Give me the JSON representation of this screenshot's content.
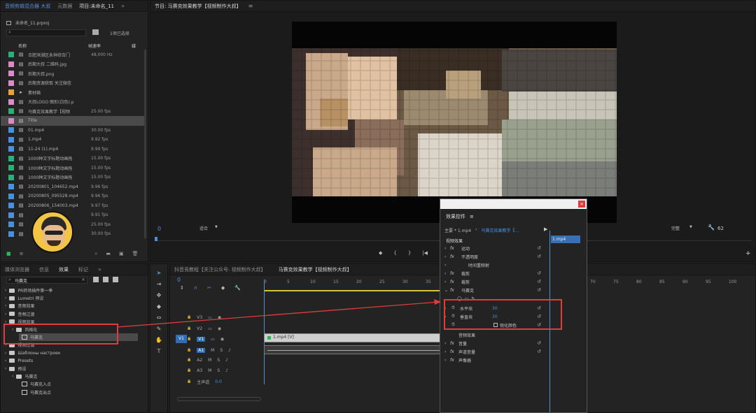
{
  "project_panel": {
    "tabs": [
      "音频剪辑混合器 大叔",
      "元数据",
      "项目:未命名_11"
    ],
    "file": "未命名_11.prproj",
    "search_placeholder": "",
    "count": "1项已选择",
    "col_name": "名称",
    "col_rate": "帧速率",
    "col_extra": "媒",
    "items": [
      {
        "color": "#27b07a",
        "name": "合肥滨湖区永祥综合门",
        "rate": "48,000 Hz"
      },
      {
        "color": "#d98cc8",
        "name": "后期大叔 二维码.jpg",
        "rate": ""
      },
      {
        "color": "#d98cc8",
        "name": "后期大叔.png",
        "rate": ""
      },
      {
        "color": "#d98cc8",
        "name": "后期资源获取 关注微信",
        "rate": ""
      },
      {
        "color": "#e8a23a",
        "name": "素材箱",
        "rate": ""
      },
      {
        "color": "#d98cc8",
        "name": "大叔LOGO 图形(白色).p",
        "rate": ""
      },
      {
        "color": "#27b07a",
        "name": "马赛克效果教学【视频",
        "rate": "25.00 fps"
      },
      {
        "color": "#d98cc8",
        "name": "Title",
        "rate": ""
      },
      {
        "color": "#4a90e2",
        "name": "01.mp4",
        "rate": "30.00 fps"
      },
      {
        "color": "#4a90e2",
        "name": "1.mp4",
        "rate": "9.92 fps"
      },
      {
        "color": "#4a90e2",
        "name": "11-24 (1).mp4",
        "rate": "9.99 fps"
      },
      {
        "color": "#27b07a",
        "name": "1000种文字标题动画拖",
        "rate": "15.00 fps"
      },
      {
        "color": "#27b07a",
        "name": "1000种文字标题动画拖",
        "rate": "15.00 fps"
      },
      {
        "color": "#27b07a",
        "name": "1000种文字标题动画拖",
        "rate": "15.00 fps"
      },
      {
        "color": "#4a90e2",
        "name": "20200801_104652.mp4",
        "rate": "9.96 fps"
      },
      {
        "color": "#4a90e2",
        "name": "20200805_095528.mp4",
        "rate": "9.96 fps"
      },
      {
        "color": "#4a90e2",
        "name": "20200806_154003.mp4",
        "rate": "9.97 fps"
      },
      {
        "color": "#4a90e2",
        "name": "",
        "rate": "9.91 fps"
      },
      {
        "color": "#4a90e2",
        "name": "",
        "rate": "25.00 fps"
      },
      {
        "color": "#4a90e2",
        "name": "",
        "rate": "30.00 fps"
      }
    ]
  },
  "program_monitor": {
    "title": "节目: 马赛克效果教学【视频制作大叔】",
    "timecode": "0",
    "fit": "适合",
    "quality": "完整",
    "end_time": "62"
  },
  "effects_panel": {
    "tabs": [
      "媒体浏览器",
      "信息",
      "效果",
      "标记"
    ],
    "search_value": "马赛克",
    "tree": [
      {
        "label": "PR转场插件第一季",
        "level": 0
      },
      {
        "label": "Lumetri 预设",
        "level": 0
      },
      {
        "label": "音频效果",
        "level": 0
      },
      {
        "label": "音频过渡",
        "level": 0
      },
      {
        "label": "视频效果",
        "level": 0
      },
      {
        "label": "风格化",
        "level": 1
      },
      {
        "label": "马赛克",
        "level": 2
      },
      {
        "label": "视频过渡",
        "level": 0
      },
      {
        "label": "Шаблоны настроек",
        "level": 0
      },
      {
        "label": "Presets",
        "level": 0
      },
      {
        "label": "预设",
        "level": 0
      },
      {
        "label": "马赛克",
        "level": 1
      },
      {
        "label": "马赛克入点",
        "level": 2
      },
      {
        "label": "马赛克出点",
        "level": 2
      }
    ]
  },
  "timeline": {
    "tabs": [
      "抖音竞教程【关注公众号: 视频制作大叔】",
      "马赛克效果教学【视频制作大叔】"
    ],
    "timecode": "0",
    "ruler": [
      "0",
      "5",
      "10",
      "15",
      "20",
      "25",
      "30",
      "35",
      "70",
      "75",
      "80",
      "85",
      "90",
      "95",
      "100"
    ],
    "tracks": [
      "V3",
      "V2",
      "V1",
      "A1",
      "A2",
      "A3",
      "主声道"
    ],
    "v1_source": "V1",
    "clip_label": "1.mp4 [V]",
    "master_value": "0.0"
  },
  "effect_controls": {
    "title": "效果控件",
    "master": "主要 * 1.mp4",
    "sequence": "马赛克效果教学【...",
    "clip_tag": "1.mp4",
    "section": "视频效果",
    "rows": [
      {
        "label": "运动",
        "fx": true
      },
      {
        "label": "不透明度",
        "fx": true
      },
      {
        "label": "时间重映射",
        "fx": false
      },
      {
        "label": "裁剪",
        "fx": true
      },
      {
        "label": "裁剪",
        "fx": true
      },
      {
        "label": "马赛克",
        "fx": true
      }
    ],
    "props": [
      {
        "label": "水平块",
        "value": "30"
      },
      {
        "label": "垂直块",
        "value": "30"
      }
    ],
    "sharpen_label": "锐化颜色",
    "audio_rows": [
      "音频效果",
      "音量",
      "声道音量",
      "声像器"
    ]
  },
  "colors": {
    "accent": "#4a90e2",
    "highlight": "#e23b3b",
    "clip": "#cfcfcf",
    "audio_clip": "#3a3a3a"
  }
}
